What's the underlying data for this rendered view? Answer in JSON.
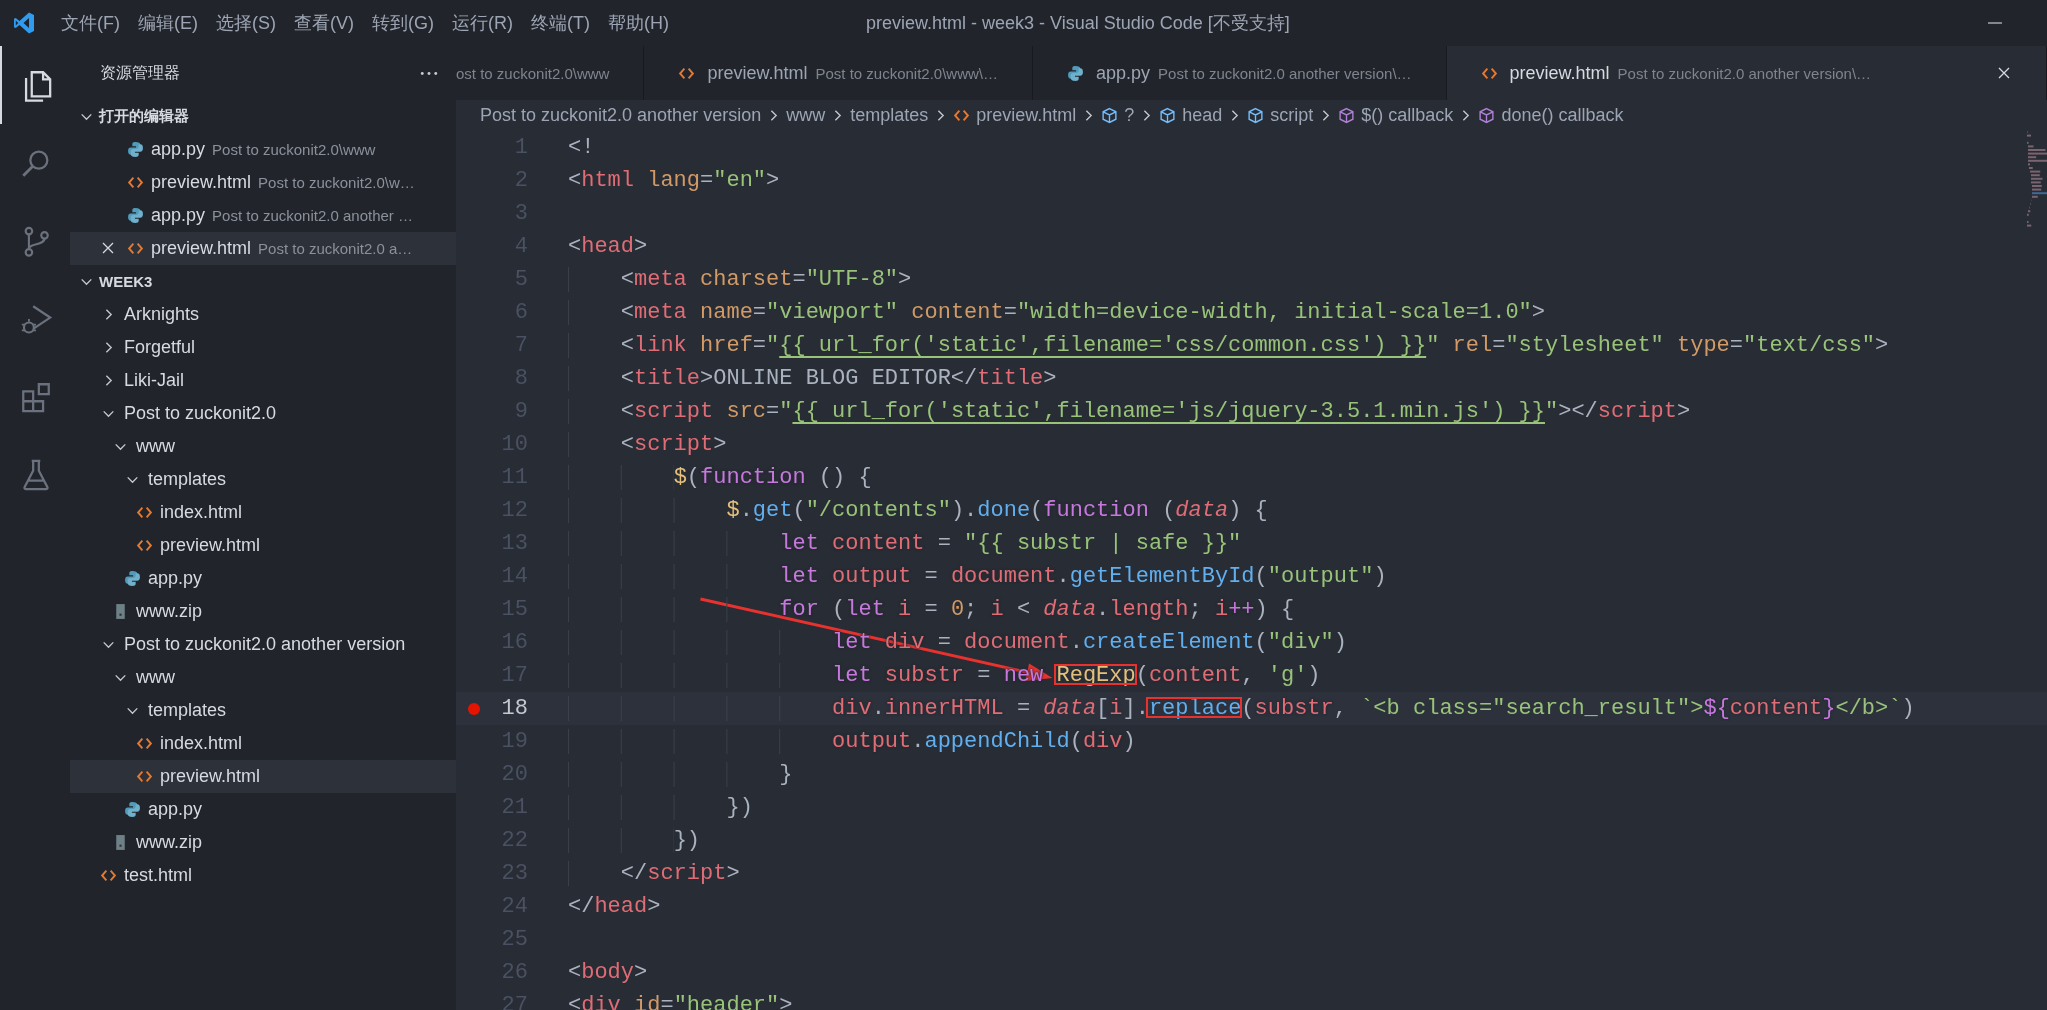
{
  "title_bar": {
    "menus": [
      "文件(F)",
      "编辑(E)",
      "选择(S)",
      "查看(V)",
      "转到(G)",
      "运行(R)",
      "终端(T)",
      "帮助(H)"
    ],
    "title": "preview.html - week3 - Visual Studio Code [不受支持]"
  },
  "activity_bar": [
    {
      "kind": "files",
      "selected": true
    },
    {
      "kind": "search",
      "selected": false
    },
    {
      "kind": "source_control",
      "selected": false
    },
    {
      "kind": "run",
      "selected": false
    },
    {
      "kind": "extensions",
      "selected": false
    },
    {
      "kind": "testing",
      "selected": false
    }
  ],
  "sidebar": {
    "title": "资源管理器",
    "open_editors": {
      "label": "打开的编辑器",
      "expanded": true,
      "items": [
        {
          "kind": "python",
          "name": "app.py",
          "description": "Post to zuckonit2.0\\www",
          "selected": false
        },
        {
          "kind": "html",
          "name": "preview.html",
          "description": "Post to zuckonit2.0\\w…",
          "selected": false
        },
        {
          "kind": "python",
          "name": "app.py",
          "description": "Post to zuckonit2.0 another …",
          "selected": false
        },
        {
          "kind": "html",
          "name": "preview.html",
          "description": "Post to zuckonit2.0 a…",
          "selected": true
        }
      ]
    },
    "folder": {
      "label": "WEEK3",
      "expanded": true,
      "items": [
        {
          "kind": "folder",
          "label": "Arknights",
          "expanded": false,
          "selected": false
        },
        {
          "kind": "folder",
          "label": "Forgetful",
          "expanded": false,
          "selected": false
        },
        {
          "kind": "folder",
          "label": "Liki-Jail",
          "expanded": false,
          "selected": false
        },
        {
          "kind": "folder",
          "label": "Post to zuckonit2.0",
          "expanded": true,
          "selected": false,
          "children": [
            {
              "kind": "folder",
              "label": "www",
              "expanded": true,
              "selected": false,
              "children": [
                {
                  "kind": "folder",
                  "label": "templates",
                  "expanded": true,
                  "selected": false,
                  "children": [
                    {
                      "kind": "html",
                      "label": "index.html",
                      "selected": false
                    },
                    {
                      "kind": "html",
                      "label": "preview.html",
                      "selected": false
                    }
                  ]
                },
                {
                  "kind": "python",
                  "label": "app.py",
                  "selected": false
                }
              ]
            },
            {
              "kind": "zip",
              "label": "www.zip",
              "selected": false
            }
          ]
        },
        {
          "kind": "folder",
          "label": "Post to zuckonit2.0 another version",
          "expanded": true,
          "selected": false,
          "children": [
            {
              "kind": "folder",
              "label": "www",
              "expanded": true,
              "selected": false,
              "children": [
                {
                  "kind": "folder",
                  "label": "templates",
                  "expanded": true,
                  "selected": false,
                  "children": [
                    {
                      "kind": "html",
                      "label": "index.html",
                      "selected": false
                    },
                    {
                      "kind": "html",
                      "label": "preview.html",
                      "selected": true
                    }
                  ]
                },
                {
                  "kind": "python",
                  "label": "app.py",
                  "selected": false
                }
              ]
            },
            {
              "kind": "zip",
              "label": "www.zip",
              "selected": false
            }
          ]
        },
        {
          "kind": "html",
          "label": "test.html",
          "selected": false
        }
      ]
    }
  },
  "tabs": [
    {
      "kind": "none",
      "description": "ost to zuckonit2.0\\www",
      "selected": false
    },
    {
      "kind": "html",
      "name": "preview.html",
      "description": "Post to zuckonit2.0\\www\\…",
      "selected": false
    },
    {
      "kind": "python",
      "name": "app.py",
      "description": "Post to zuckonit2.0 another version\\…",
      "selected": false
    },
    {
      "kind": "html",
      "name": "preview.html",
      "description": "Post to zuckonit2.0 another version\\…",
      "selected": true
    }
  ],
  "breadcrumbs": [
    {
      "kind": "folder",
      "label": "Post to zuckonit2.0 another version"
    },
    {
      "kind": "folder",
      "label": "www"
    },
    {
      "kind": "folder",
      "label": "templates"
    },
    {
      "kind": "html",
      "label": "preview.html"
    },
    {
      "kind": "element",
      "label": "?"
    },
    {
      "kind": "element",
      "label": "head"
    },
    {
      "kind": "element",
      "label": "script"
    },
    {
      "kind": "function",
      "label": "$() callback"
    },
    {
      "kind": "function",
      "label": "done() callback"
    }
  ],
  "editor": {
    "lines": [
      {
        "number": "1",
        "breakpoint": false,
        "current": false,
        "tokens": [
          {
            "kind": "punct",
            "text": "<!"
          }
        ]
      },
      {
        "number": "2",
        "breakpoint": false,
        "current": false,
        "tokens": [
          {
            "kind": "punct",
            "text": "<"
          },
          {
            "kind": "tag",
            "text": "html"
          },
          {
            "kind": "attr",
            "text": " lang"
          },
          {
            "kind": "punct",
            "text": "="
          },
          {
            "kind": "string",
            "text": "\"en\""
          },
          {
            "kind": "punct",
            "text": ">"
          }
        ]
      },
      {
        "number": "3",
        "breakpoint": false,
        "current": false
      },
      {
        "number": "4",
        "breakpoint": false,
        "current": false,
        "tokens": [
          {
            "kind": "punct",
            "text": "<"
          },
          {
            "kind": "tag",
            "text": "head"
          },
          {
            "kind": "punct",
            "text": ">"
          }
        ]
      },
      {
        "number": "5",
        "breakpoint": false,
        "current": false,
        "tokens": [
          {
            "kind": "punct",
            "text": "    <"
          },
          {
            "kind": "tag",
            "text": "meta"
          },
          {
            "kind": "attr",
            "text": " charset"
          },
          {
            "kind": "punct",
            "text": "="
          },
          {
            "kind": "string",
            "text": "\"UTF-8\""
          },
          {
            "kind": "punct",
            "text": ">"
          }
        ]
      },
      {
        "number": "6",
        "breakpoint": false,
        "current": false,
        "tokens": [
          {
            "kind": "punct",
            "text": "    <"
          },
          {
            "kind": "tag",
            "text": "meta"
          },
          {
            "kind": "attr",
            "text": " name"
          },
          {
            "kind": "punct",
            "text": "="
          },
          {
            "kind": "string",
            "text": "\"viewport\""
          },
          {
            "kind": "attr",
            "text": " content"
          },
          {
            "kind": "punct",
            "text": "="
          },
          {
            "kind": "string",
            "text": "\"width=device-width, initial-scale=1.0\""
          },
          {
            "kind": "punct",
            "text": ">"
          }
        ]
      },
      {
        "number": "7",
        "breakpoint": false,
        "current": false,
        "tokens": [
          {
            "kind": "punct",
            "text": "    <"
          },
          {
            "kind": "tag",
            "text": "link"
          },
          {
            "kind": "attr",
            "text": " href"
          },
          {
            "kind": "punct",
            "text": "="
          },
          {
            "kind": "string",
            "text": "\""
          },
          {
            "kind": "template",
            "text": "{{ url_for('static',filename='css/common.css') }}"
          },
          {
            "kind": "string",
            "text": "\""
          },
          {
            "kind": "attr",
            "text": " rel"
          },
          {
            "kind": "punct",
            "text": "="
          },
          {
            "kind": "string",
            "text": "\"stylesheet\""
          },
          {
            "kind": "attr",
            "text": " type"
          },
          {
            "kind": "punct",
            "text": "="
          },
          {
            "kind": "string",
            "text": "\"text/css\""
          },
          {
            "kind": "punct",
            "text": ">"
          }
        ]
      },
      {
        "number": "8",
        "breakpoint": false,
        "current": false,
        "tokens": [
          {
            "kind": "punct",
            "text": "    <"
          },
          {
            "kind": "tag",
            "text": "title"
          },
          {
            "kind": "punct",
            "text": ">ONLINE BLOG EDITOR</"
          },
          {
            "kind": "tag",
            "text": "title"
          },
          {
            "kind": "punct",
            "text": ">"
          }
        ]
      },
      {
        "number": "9",
        "breakpoint": false,
        "current": false,
        "tokens": [
          {
            "kind": "punct",
            "text": "    <"
          },
          {
            "kind": "tag",
            "text": "script"
          },
          {
            "kind": "attr",
            "text": " src"
          },
          {
            "kind": "punct",
            "text": "="
          },
          {
            "kind": "string",
            "text": "\""
          },
          {
            "kind": "template",
            "text": "{{ url_for('static',filename='js/jquery-3.5.1.min.js') }}"
          },
          {
            "kind": "string",
            "text": "\""
          },
          {
            "kind": "punct",
            "text": "></"
          },
          {
            "kind": "tag",
            "text": "script"
          },
          {
            "kind": "punct",
            "text": ">"
          }
        ]
      },
      {
        "number": "10",
        "breakpoint": false,
        "current": false,
        "tokens": [
          {
            "kind": "punct",
            "text": "    <"
          },
          {
            "kind": "tag",
            "text": "script"
          },
          {
            "kind": "punct",
            "text": ">"
          }
        ]
      },
      {
        "number": "11",
        "breakpoint": false,
        "current": false,
        "tokens": [
          {
            "kind": "ident",
            "text": "        $"
          },
          {
            "kind": "punct",
            "text": "("
          },
          {
            "kind": "keyword",
            "text": "function"
          },
          {
            "kind": "punct",
            "text": " () {"
          }
        ]
      },
      {
        "number": "12",
        "breakpoint": false,
        "current": false,
        "tokens": [
          {
            "kind": "ident",
            "text": "            $"
          },
          {
            "kind": "punct",
            "text": "."
          },
          {
            "kind": "function",
            "text": "get"
          },
          {
            "kind": "punct",
            "text": "("
          },
          {
            "kind": "string",
            "text": "\"/contents\""
          },
          {
            "kind": "punct",
            "text": ")."
          },
          {
            "kind": "function",
            "text": "done"
          },
          {
            "kind": "punct",
            "text": "("
          },
          {
            "kind": "keyword",
            "text": "function"
          },
          {
            "kind": "punct",
            "text": " ("
          },
          {
            "kind": "param",
            "text": "data"
          },
          {
            "kind": "punct",
            "text": ") {"
          }
        ]
      },
      {
        "number": "13",
        "breakpoint": false,
        "current": false,
        "tokens": [
          {
            "kind": "keyword",
            "text": "                let"
          },
          {
            "kind": "variable",
            "text": " content"
          },
          {
            "kind": "punct",
            "text": " = "
          },
          {
            "kind": "string",
            "text": "\"{{ substr | safe }}\""
          }
        ]
      },
      {
        "number": "14",
        "breakpoint": false,
        "current": false,
        "tokens": [
          {
            "kind": "keyword",
            "text": "                let"
          },
          {
            "kind": "variable",
            "text": " output"
          },
          {
            "kind": "punct",
            "text": " = "
          },
          {
            "kind": "variable",
            "text": "document"
          },
          {
            "kind": "punct",
            "text": "."
          },
          {
            "kind": "function",
            "text": "getElementById"
          },
          {
            "kind": "punct",
            "text": "("
          },
          {
            "kind": "string",
            "text": "\"output\""
          },
          {
            "kind": "punct",
            "text": ")"
          }
        ]
      },
      {
        "number": "15",
        "breakpoint": false,
        "current": false,
        "tokens": [
          {
            "kind": "keyword",
            "text": "                for"
          },
          {
            "kind": "punct",
            "text": " ("
          },
          {
            "kind": "keyword",
            "text": "let"
          },
          {
            "kind": "variable",
            "text": " i"
          },
          {
            "kind": "punct",
            "text": " = "
          },
          {
            "kind": "number",
            "text": "0"
          },
          {
            "kind": "punct",
            "text": "; "
          },
          {
            "kind": "variable",
            "text": "i"
          },
          {
            "kind": "punct",
            "text": " < "
          },
          {
            "kind": "param",
            "text": "data"
          },
          {
            "kind": "punct",
            "text": "."
          },
          {
            "kind": "variable",
            "text": "length"
          },
          {
            "kind": "punct",
            "text": "; "
          },
          {
            "kind": "variable",
            "text": "i"
          },
          {
            "kind": "keyword",
            "text": "++"
          },
          {
            "kind": "punct",
            "text": ") {"
          }
        ]
      },
      {
        "number": "16",
        "breakpoint": false,
        "current": false,
        "tokens": [
          {
            "kind": "keyword",
            "text": "                    let"
          },
          {
            "kind": "variable",
            "text": " div"
          },
          {
            "kind": "punct",
            "text": " = "
          },
          {
            "kind": "variable",
            "text": "document"
          },
          {
            "kind": "punct",
            "text": "."
          },
          {
            "kind": "function",
            "text": "createElement"
          },
          {
            "kind": "punct",
            "text": "("
          },
          {
            "kind": "string",
            "text": "\"div\""
          },
          {
            "kind": "punct",
            "text": ")"
          }
        ]
      },
      {
        "number": "17",
        "breakpoint": false,
        "current": false,
        "tokens": [
          {
            "kind": "keyword",
            "text": "                    let"
          },
          {
            "kind": "variable",
            "text": " substr"
          },
          {
            "kind": "punct",
            "text": " = "
          },
          {
            "kind": "keyword",
            "text": "new "
          },
          {
            "kind": "ident",
            "text": "RegExp",
            "boxed": true
          },
          {
            "kind": "punct",
            "text": "("
          },
          {
            "kind": "variable",
            "text": "content"
          },
          {
            "kind": "punct",
            "text": ", "
          },
          {
            "kind": "string",
            "text": "'g'"
          },
          {
            "kind": "punct",
            "text": ")"
          }
        ]
      },
      {
        "number": "18",
        "breakpoint": true,
        "current": true,
        "tokens": [
          {
            "kind": "variable",
            "text": "                    div"
          },
          {
            "kind": "punct",
            "text": "."
          },
          {
            "kind": "variable",
            "text": "innerHTML"
          },
          {
            "kind": "punct",
            "text": " = "
          },
          {
            "kind": "param",
            "text": "data"
          },
          {
            "kind": "punct",
            "text": "["
          },
          {
            "kind": "variable",
            "text": "i"
          },
          {
            "kind": "punct",
            "text": "]."
          },
          {
            "kind": "function",
            "text": "replace",
            "boxed": true
          },
          {
            "kind": "punct",
            "text": "("
          },
          {
            "kind": "variable",
            "text": "substr"
          },
          {
            "kind": "punct",
            "text": ", "
          },
          {
            "kind": "string",
            "text": "`<b class=\"search_result\">"
          },
          {
            "kind": "keyword",
            "text": "${"
          },
          {
            "kind": "variable",
            "text": "content"
          },
          {
            "kind": "keyword",
            "text": "}"
          },
          {
            "kind": "string",
            "text": "</b>`"
          },
          {
            "kind": "punct",
            "text": ")"
          }
        ]
      },
      {
        "number": "19",
        "breakpoint": false,
        "current": false,
        "tokens": [
          {
            "kind": "variable",
            "text": "                    output"
          },
          {
            "kind": "punct",
            "text": "."
          },
          {
            "kind": "function",
            "text": "appendChild"
          },
          {
            "kind": "punct",
            "text": "("
          },
          {
            "kind": "variable",
            "text": "div"
          },
          {
            "kind": "punct",
            "text": ")"
          }
        ]
      },
      {
        "number": "20",
        "breakpoint": false,
        "current": false,
        "tokens": [
          {
            "kind": "punct",
            "text": "                }"
          }
        ]
      },
      {
        "number": "21",
        "breakpoint": false,
        "current": false,
        "tokens": [
          {
            "kind": "punct",
            "text": "            })"
          }
        ]
      },
      {
        "number": "22",
        "breakpoint": false,
        "current": false,
        "tokens": [
          {
            "kind": "punct",
            "text": "        })"
          }
        ]
      },
      {
        "number": "23",
        "breakpoint": false,
        "current": false,
        "tokens": [
          {
            "kind": "punct",
            "text": "    </"
          },
          {
            "kind": "tag",
            "text": "script"
          },
          {
            "kind": "punct",
            "text": ">"
          }
        ]
      },
      {
        "number": "24",
        "breakpoint": false,
        "current": false,
        "tokens": [
          {
            "kind": "punct",
            "text": "</"
          },
          {
            "kind": "tag",
            "text": "head"
          },
          {
            "kind": "punct",
            "text": ">"
          }
        ]
      },
      {
        "number": "25",
        "breakpoint": false,
        "current": false
      },
      {
        "number": "26",
        "breakpoint": false,
        "current": false,
        "tokens": [
          {
            "kind": "punct",
            "text": "<"
          },
          {
            "kind": "tag",
            "text": "body"
          },
          {
            "kind": "punct",
            "text": ">"
          }
        ]
      },
      {
        "number": "27",
        "breakpoint": false,
        "current": false,
        "tokens": [
          {
            "kind": "punct",
            "text": "<"
          },
          {
            "kind": "tag",
            "text": "div"
          },
          {
            "kind": "attr",
            "text": " id"
          },
          {
            "kind": "punct",
            "text": "="
          },
          {
            "kind": "string",
            "text": "\"header\""
          },
          {
            "kind": "punct",
            "text": ">"
          }
        ]
      }
    ]
  }
}
